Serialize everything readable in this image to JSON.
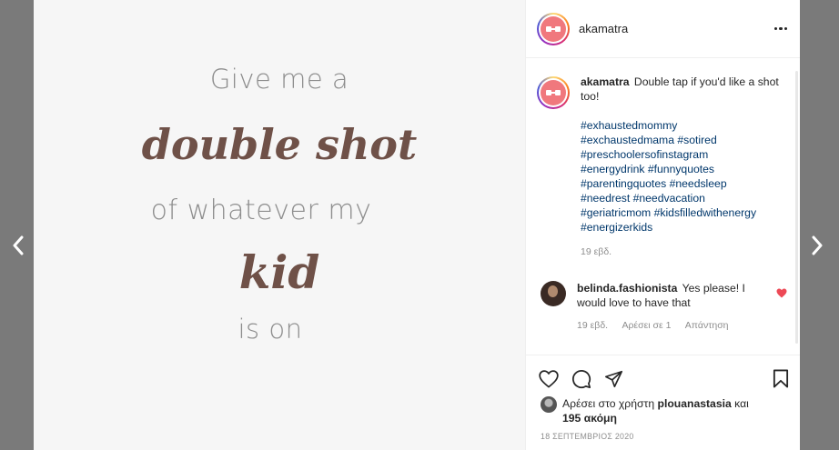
{
  "post": {
    "quote": {
      "line1": "Give me a",
      "line2": "double shot",
      "line3": "of whatever my",
      "line4": "kid",
      "line5": "is on"
    }
  },
  "header": {
    "username": "akamatra"
  },
  "caption": {
    "username": "akamatra",
    "text": "Double tap if you'd like a shot too!",
    "hashtags": [
      "#exhaustedmommy",
      "#exchaustedmama #sotired",
      "#preschoolersofinstagram",
      "#energydrink #funnyquotes",
      "#parentingquotes #needsleep",
      "#needrest #needvacation",
      "#geriatricmom #kidsfilledwithenergy",
      "#energizerkids"
    ],
    "age": "19 εβδ."
  },
  "comment": {
    "username": "belinda.fashionista",
    "text": "Yes please! I would love to have that",
    "age": "19 εβδ.",
    "likes": "Αρέσει σε 1",
    "reply": "Απάντηση"
  },
  "likes_line": {
    "prefix": "Αρέσει στο χρήστη",
    "user": "plouanastasia",
    "middle": "και",
    "count": "195 ακόμη"
  },
  "date": "18 ΣΕΠΤΕΜΒΡΙΟΣ 2020",
  "colors": {
    "overlay": "#7a7a7a",
    "hashtag": "#00376b",
    "heart": "#ed4956",
    "avatar": "#f0787d"
  },
  "icons": [
    "chevron-left-icon",
    "chevron-right-icon",
    "more-icon",
    "heart-icon",
    "comment-icon",
    "share-icon",
    "bookmark-icon"
  ]
}
